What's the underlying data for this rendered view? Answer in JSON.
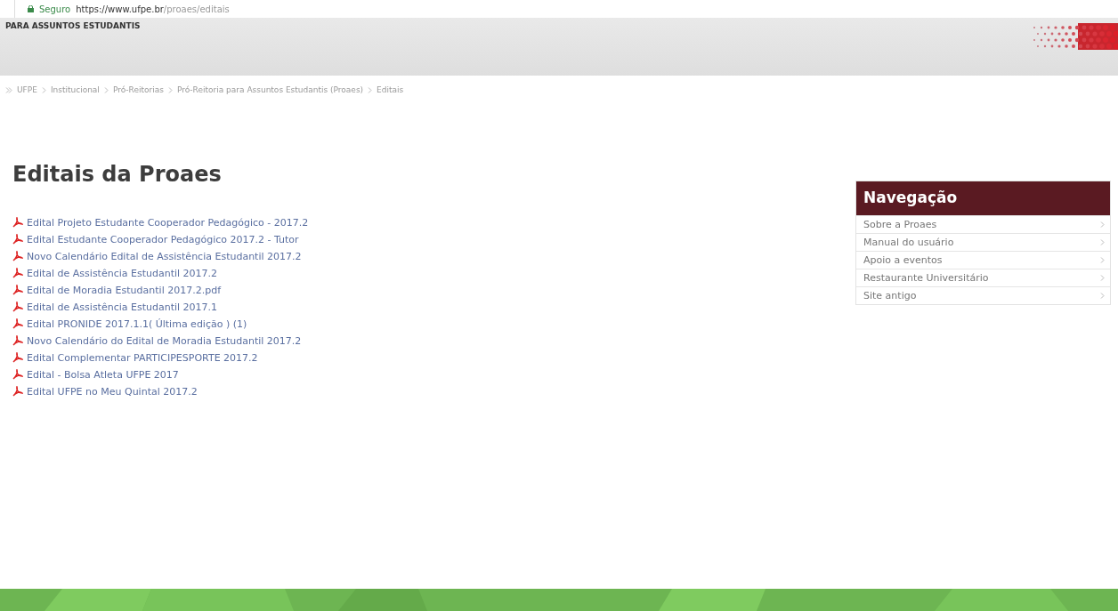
{
  "address_bar": {
    "security": "Seguro",
    "url_host": "https://www.ufpe.br",
    "url_path": "/proaes/editais"
  },
  "header": {
    "title": "PARA ASSUNTOS ESTUDANTIS"
  },
  "breadcrumb": [
    "UFPE",
    "Institucional",
    "Pró-Reitorias",
    "Pró-Reitoria para Assuntos Estudantis (Proaes)",
    "Editais"
  ],
  "page_title": "Editais da Proaes",
  "documents": [
    "Edital Projeto Estudante Cooperador Pedagógico - 2017.2",
    "Edital Estudante Cooperador Pedagógico 2017.2 - Tutor",
    "Novo Calendário Edital de Assistência Estudantil 2017.2",
    "Edital de Assistência Estudantil 2017.2",
    "Edital de Moradia Estudantil 2017.2.pdf",
    "Edital de Assistência Estudantil 2017.1",
    "Edital PRONIDE 2017.1.1( Última edição ) (1)",
    "Novo Calendário do Edital de Moradia Estudantil 2017.2",
    "Edital Complementar PARTICIPESPORTE 2017.2",
    "Edital - Bolsa Atleta UFPE 2017",
    "Edital UFPE no Meu Quintal 2017.2"
  ],
  "navigation": {
    "title": "Navegação",
    "items": [
      "Sobre a Proaes",
      "Manual do usuário",
      "Apoio a eventos",
      "Restaurante Universitário",
      "Site antigo"
    ]
  }
}
